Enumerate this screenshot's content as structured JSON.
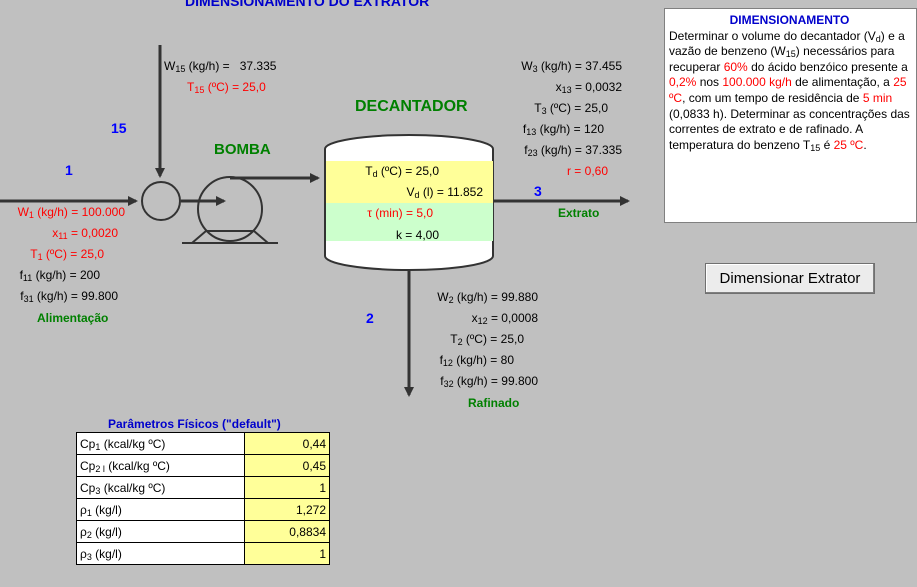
{
  "title": "DIMENSIONAMENTO DO EXTRATOR",
  "decantador_label": "DECANTADOR",
  "bomba_label": "BOMBA",
  "streams": {
    "s15": {
      "num": "15",
      "w_label": "W",
      "w_sub": "15",
      "w_unit": " (kg/h) =",
      "w_value": "37.335",
      "t_label": "T",
      "t_sub": "15",
      "t_unit": " (ºC) =",
      "t_value": "25,0"
    },
    "s1": {
      "num": "1",
      "w_label": "W",
      "w_sub": "1",
      "w_unit": " (kg/h) =",
      "w_value": "100.000",
      "x_label": "x",
      "x_sub": "11",
      "x_unit": " =",
      "x_value": "0,0020",
      "t_label": "T",
      "t_sub": "1",
      "t_unit": " (ºC) =",
      "t_value": "25,0",
      "f11_label": "f",
      "f11_sub": "11",
      "f11_unit": " (kg/h) =",
      "f11_value": "200",
      "f31_label": "f",
      "f31_sub": "31",
      "f31_unit": " (kg/h) =",
      "f31_value": "99.800",
      "name": "Alimentação"
    },
    "s3": {
      "num": "3",
      "w_label": "W",
      "w_sub": "3",
      "w_unit": " (kg/h) =",
      "w_value": "37.455",
      "x_label": "x",
      "x_sub": "13",
      "x_unit": " =",
      "x_value": "0,0032",
      "t_label": "T",
      "t_sub": "3",
      "t_unit": " (ºC) =",
      "t_value": "25,0",
      "f13_label": "f",
      "f13_sub": "13",
      "f13_unit": " (kg/h) =",
      "f13_value": "120",
      "f23_label": "f",
      "f23_sub": "23",
      "f23_unit": " (kg/h) =",
      "f23_value": "37.335",
      "r_label": "r =",
      "r_value": "0,60",
      "name": "Extrato"
    },
    "s2": {
      "num": "2",
      "w_label": "W",
      "w_sub": "2",
      "w_unit": " (kg/h) =",
      "w_value": "99.880",
      "x_label": "x",
      "x_sub": "12",
      "x_unit": " =",
      "x_value": "0,0008",
      "t_label": "T",
      "t_sub": "2",
      "t_unit": " (ºC) =",
      "t_value": "25,0",
      "f12_label": "f",
      "f12_sub": "12",
      "f12_unit": " (kg/h) =",
      "f12_value": "80",
      "f32_label": "f",
      "f32_sub": "32",
      "f32_unit": " (kg/h) =",
      "f32_value": "99.800",
      "name": "Rafinado"
    }
  },
  "decanter": {
    "td_label": "T",
    "td_sub": "d",
    "td_unit": " (ºC) =",
    "td_value": "25,0",
    "vd_label": "V",
    "vd_sub": "d",
    "vd_unit": " (l) =",
    "vd_value": "11.852",
    "tau_label": "τ (min) =",
    "tau_value": "5,0",
    "k_label": "k =",
    "k_value": "4,00"
  },
  "info": {
    "title": "DIMENSIONAMENTO",
    "t1": "Determinar o volume do decantador  (V",
    "t1_sub": "d",
    "t2": ") e a vazão de benzeno  (W",
    "t2_sub": "15",
    "t3": ") necessários para recuperar ",
    "h1": "60%",
    "t4": " do ácido benzóico presente a ",
    "h2": "0,2%",
    "t5": " nos ",
    "h3": "100.000 kg/h",
    "t6": " de alimentação, a ",
    "h4": "25 ºC",
    "t7": ", com um tempo de residência de ",
    "h5": "5 min",
    "t8": " (0,0833 h). Determinar as concentrações das correntes de extrato e de rafinado. A temperatura do benzeno T",
    "t8_sub": "15",
    "t9": " é ",
    "h6": "25 ºC",
    "t10": "."
  },
  "button_label": "Dimensionar Extrator",
  "params": {
    "title": "Parâmetros Físicos (\"default\")",
    "rows": [
      {
        "name": "Cp",
        "sub": "1",
        "unit": " (kcal/kg ºC)",
        "value": "0,44"
      },
      {
        "name": "Cp",
        "sub": "2 l",
        "unit": " (kcal/kg ºC)",
        "value": "0,45"
      },
      {
        "name": "Cp",
        "sub": "3",
        "unit": " (kcal/kg ºC)",
        "value": "1"
      },
      {
        "name": "ρ",
        "sub": "1",
        "unit": " (kg/l)",
        "value": "1,272"
      },
      {
        "name": "ρ",
        "sub": "2",
        "unit": " (kg/l)",
        "value": "0,8834"
      },
      {
        "name": "ρ",
        "sub": "3",
        "unit": " (kg/l)",
        "value": "1"
      }
    ]
  },
  "colors": {
    "background": "#c0c0c0",
    "highlight_red": "#ff0000",
    "label_green": "#008000",
    "stream_blue": "#0000ff",
    "yellow_cell": "#ffff99",
    "green_cell": "#ccffcc"
  }
}
